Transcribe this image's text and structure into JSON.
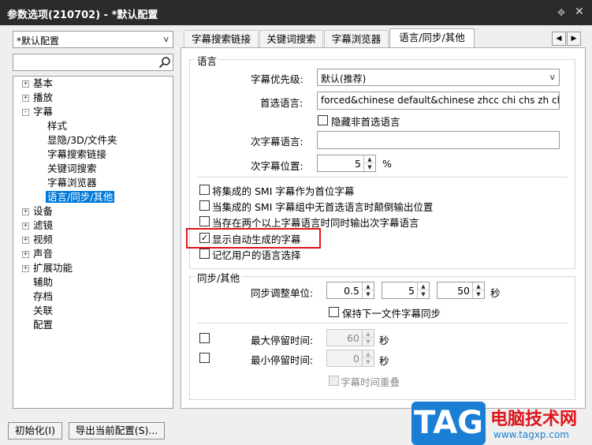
{
  "window": {
    "title": "参数选项(210702) - *默认配置",
    "pin_icon": "pin-icon",
    "close_icon": "close-icon"
  },
  "profile": {
    "selected": "*默认配置"
  },
  "search": {
    "value": "",
    "icon": "search-icon"
  },
  "tree": {
    "items": [
      {
        "label": "基本",
        "expander": "+"
      },
      {
        "label": "播放",
        "expander": "+"
      },
      {
        "label": "字幕",
        "expander": "-"
      },
      {
        "label": "样式"
      },
      {
        "label": "显隐/3D/文件夹"
      },
      {
        "label": "字幕搜索链接"
      },
      {
        "label": "关键词搜索"
      },
      {
        "label": "字幕浏览器"
      },
      {
        "label": "语言/同步/其他"
      },
      {
        "label": "设备",
        "expander": "+"
      },
      {
        "label": "滤镜",
        "expander": "+"
      },
      {
        "label": "视频",
        "expander": "+"
      },
      {
        "label": "声音",
        "expander": "+"
      },
      {
        "label": "扩展功能",
        "expander": "+"
      },
      {
        "label": "辅助"
      },
      {
        "label": "存档"
      },
      {
        "label": "关联"
      },
      {
        "label": "配置"
      }
    ]
  },
  "tabs": {
    "items": [
      "字幕搜索链接",
      "关键词搜索",
      "字幕浏览器",
      "语言/同步/其他"
    ],
    "prev": "◀",
    "next": "▶"
  },
  "language": {
    "title": "语言",
    "priority_label": "字幕优先级:",
    "priority_value": "默认(推荐)",
    "preferred_label": "首选语言:",
    "preferred_value": "forced&chinese default&chinese zhcc chi chs zh chinese",
    "hide_nonpreferred": "隐藏非首选语言",
    "secondary_label": "次字幕语言:",
    "secondary_value": "",
    "secondary_pos_label": "次字幕位置:",
    "secondary_pos_value": "5",
    "percent": "%",
    "opt1": "将集成的 SMI 字幕作为首位字幕",
    "opt2": "当集成的 SMI 字幕组中无首选语言时颠倒输出位置",
    "opt3": "当存在两个以上字幕语言时同时输出次字幕语言",
    "opt4": "显示自动生成的字幕",
    "opt4_check": "✓",
    "opt5": "记忆用户的语言选择"
  },
  "sync": {
    "title": "同步/其他",
    "unit_label": "同步调整单位:",
    "unit1": "0.5",
    "unit2": "5",
    "unit3": "50",
    "unit_suffix": "秒",
    "keep_sync": "保持下一文件字幕同步",
    "max_label": "最大停留时间:",
    "max_value": "60",
    "max_suffix": "秒",
    "min_label": "最小停留时间:",
    "min_value": "0",
    "min_suffix": "秒",
    "overlap": "字幕时间重叠"
  },
  "footer": {
    "reset": "初始化(I)",
    "export": "导出当前配置(S)..."
  },
  "watermark": {
    "logo": "TAG",
    "site_name": "电脑技术网",
    "url": "www.tagxp.com"
  }
}
